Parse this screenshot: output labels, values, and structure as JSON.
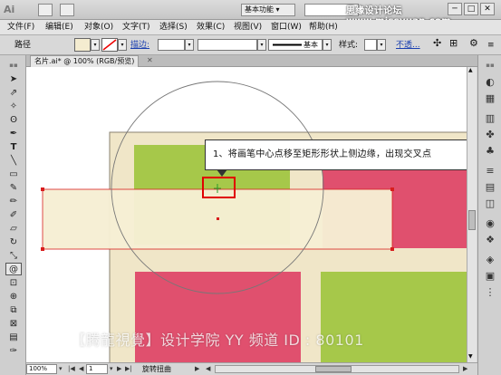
{
  "titlebar": {
    "logo": "Ai",
    "workspace_label": "基本功能 ▾",
    "watermark": "思缘设计论坛 www.missyuan.com",
    "window_buttons": [
      "─",
      "□",
      "✕"
    ]
  },
  "menubar": {
    "items": [
      "文件(F)",
      "编辑(E)",
      "对象(O)",
      "文字(T)",
      "选择(S)",
      "效果(C)",
      "视图(V)",
      "窗口(W)",
      "帮助(H)"
    ]
  },
  "controlbar": {
    "path_label": "路径",
    "stroke_label": "描边:",
    "style_preset": "基本",
    "style_label": "样式:",
    "opacity_link": "不透..."
  },
  "document": {
    "tab_label": "名片.ai* @ 100% (RGB/预览)",
    "close_icon": "✕"
  },
  "callout": {
    "text": "1、将画笔中心点移至矩形形状上侧边缘，出现交叉点"
  },
  "watermark_bottom": "【腾龍視覺】设计学院  YY 频道 ID : 80101",
  "statusbar": {
    "zoom": "100%",
    "page": "1",
    "status_text": "旋转扭曲"
  },
  "colors": {
    "card_bg": "#f0e6c8",
    "tile_green": "#a6c84a",
    "tile_pink": "#e0506e",
    "highlight_red": "#e00000",
    "selection_red": "#d81e1e"
  }
}
